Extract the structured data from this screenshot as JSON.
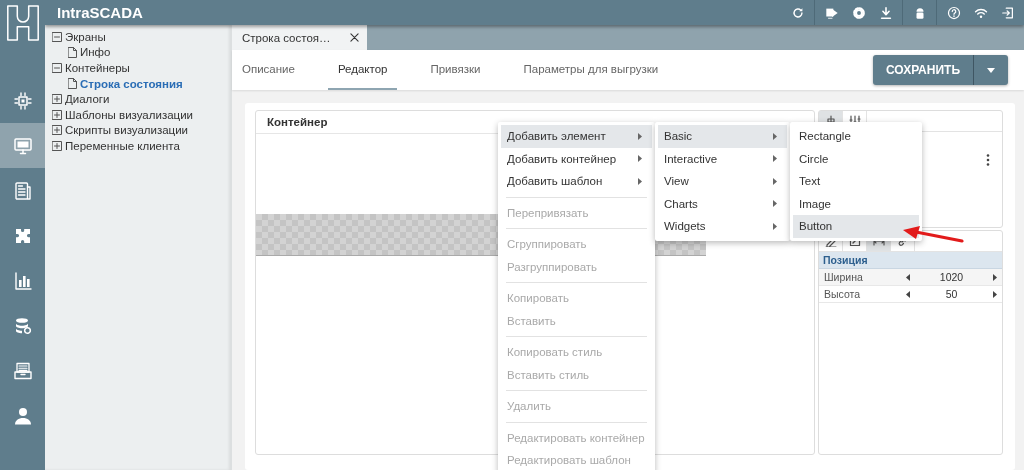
{
  "app_title": "IntraSCADA",
  "rail": [
    {
      "kind": "chip",
      "selected": false
    },
    {
      "kind": "monitor",
      "selected": true
    },
    {
      "kind": "document",
      "selected": false
    },
    {
      "kind": "puzzle",
      "selected": false
    },
    {
      "kind": "bars",
      "selected": false
    },
    {
      "kind": "database",
      "selected": false
    },
    {
      "kind": "archive",
      "selected": false
    },
    {
      "kind": "user",
      "selected": false
    }
  ],
  "tree": [
    {
      "label": "Экраны",
      "expanded": true,
      "selected": false,
      "children": [
        {
          "label": "Инфо",
          "selected": false
        }
      ]
    },
    {
      "label": "Контейнеры",
      "expanded": true,
      "selected": false,
      "children": [
        {
          "label": "Строка состояния",
          "selected": true
        }
      ]
    },
    {
      "label": "Диалоги",
      "expanded": false,
      "selected": false
    },
    {
      "label": "Шаблоны визуализации",
      "expanded": false,
      "selected": false
    },
    {
      "label": "Скрипты визуализации",
      "expanded": false,
      "selected": false
    },
    {
      "label": "Переменные клиента",
      "expanded": false,
      "selected": false
    }
  ],
  "document_tabs": [
    {
      "label": "Строка состоя…",
      "selected": true
    }
  ],
  "tabs": [
    {
      "label": "Описание",
      "selected": false
    },
    {
      "label": "Редактор",
      "selected": true
    },
    {
      "label": "Привязки",
      "selected": false
    },
    {
      "label": "Параметры для выгрузки",
      "selected": false
    }
  ],
  "save_button": "СОХРАНИТЬ",
  "container_panel": {
    "title": "Контейнер"
  },
  "layout_tools": [
    {
      "kind": "align",
      "selected": true
    },
    {
      "kind": "distribute",
      "selected": false
    }
  ],
  "property_tools": [
    {
      "kind": "pen",
      "selected": false
    },
    {
      "kind": "edit",
      "selected": false
    },
    {
      "kind": "resize",
      "selected": true
    },
    {
      "kind": "link",
      "selected": false
    }
  ],
  "properties": {
    "section": "Позиция",
    "rows": [
      {
        "name": "Ширина",
        "value": "1020"
      },
      {
        "name": "Высота",
        "value": "50"
      }
    ]
  },
  "context_menus": [
    {
      "items": [
        {
          "kind": "item",
          "label": "Добавить элемент",
          "submenu": true,
          "disabled": false,
          "selected": true
        },
        {
          "kind": "item",
          "label": "Добавить контейнер",
          "submenu": true,
          "disabled": false,
          "selected": false
        },
        {
          "kind": "item",
          "label": "Добавить шаблон",
          "submenu": true,
          "disabled": false,
          "selected": false
        },
        {
          "kind": "divider"
        },
        {
          "kind": "item",
          "label": "Перепривязать",
          "submenu": false,
          "disabled": true,
          "selected": false
        },
        {
          "kind": "divider"
        },
        {
          "kind": "item",
          "label": "Сгруппировать",
          "submenu": false,
          "disabled": true,
          "selected": false
        },
        {
          "kind": "item",
          "label": "Разгруппировать",
          "submenu": false,
          "disabled": true,
          "selected": false
        },
        {
          "kind": "divider"
        },
        {
          "kind": "item",
          "label": "Копировать",
          "submenu": false,
          "disabled": true,
          "selected": false
        },
        {
          "kind": "item",
          "label": "Вставить",
          "submenu": false,
          "disabled": true,
          "selected": false
        },
        {
          "kind": "divider"
        },
        {
          "kind": "item",
          "label": "Копировать стиль",
          "submenu": false,
          "disabled": true,
          "selected": false
        },
        {
          "kind": "item",
          "label": "Вставить стиль",
          "submenu": false,
          "disabled": true,
          "selected": false
        },
        {
          "kind": "divider"
        },
        {
          "kind": "item",
          "label": "Удалить",
          "submenu": false,
          "disabled": true,
          "selected": false
        },
        {
          "kind": "divider"
        },
        {
          "kind": "item",
          "label": "Редактировать контейнер",
          "submenu": false,
          "disabled": true,
          "selected": false
        },
        {
          "kind": "item",
          "label": "Редактировать шаблон",
          "submenu": false,
          "disabled": true,
          "selected": false
        }
      ]
    },
    {
      "items": [
        {
          "kind": "item",
          "label": "Basic",
          "submenu": true,
          "disabled": false,
          "selected": true
        },
        {
          "kind": "item",
          "label": "Interactive",
          "submenu": true,
          "disabled": false,
          "selected": false
        },
        {
          "kind": "item",
          "label": "View",
          "submenu": true,
          "disabled": false,
          "selected": false
        },
        {
          "kind": "item",
          "label": "Charts",
          "submenu": true,
          "disabled": false,
          "selected": false
        },
        {
          "kind": "item",
          "label": "Widgets",
          "submenu": true,
          "disabled": false,
          "selected": false
        }
      ]
    },
    {
      "items": [
        {
          "kind": "item",
          "label": "Rectangle",
          "submenu": false,
          "disabled": false,
          "selected": false
        },
        {
          "kind": "item",
          "label": "Circle",
          "submenu": false,
          "disabled": false,
          "selected": false
        },
        {
          "kind": "item",
          "label": "Text",
          "submenu": false,
          "disabled": false,
          "selected": false
        },
        {
          "kind": "item",
          "label": "Image",
          "submenu": false,
          "disabled": false,
          "selected": false
        },
        {
          "kind": "item",
          "label": "Button",
          "submenu": false,
          "disabled": false,
          "selected": true
        }
      ]
    }
  ]
}
